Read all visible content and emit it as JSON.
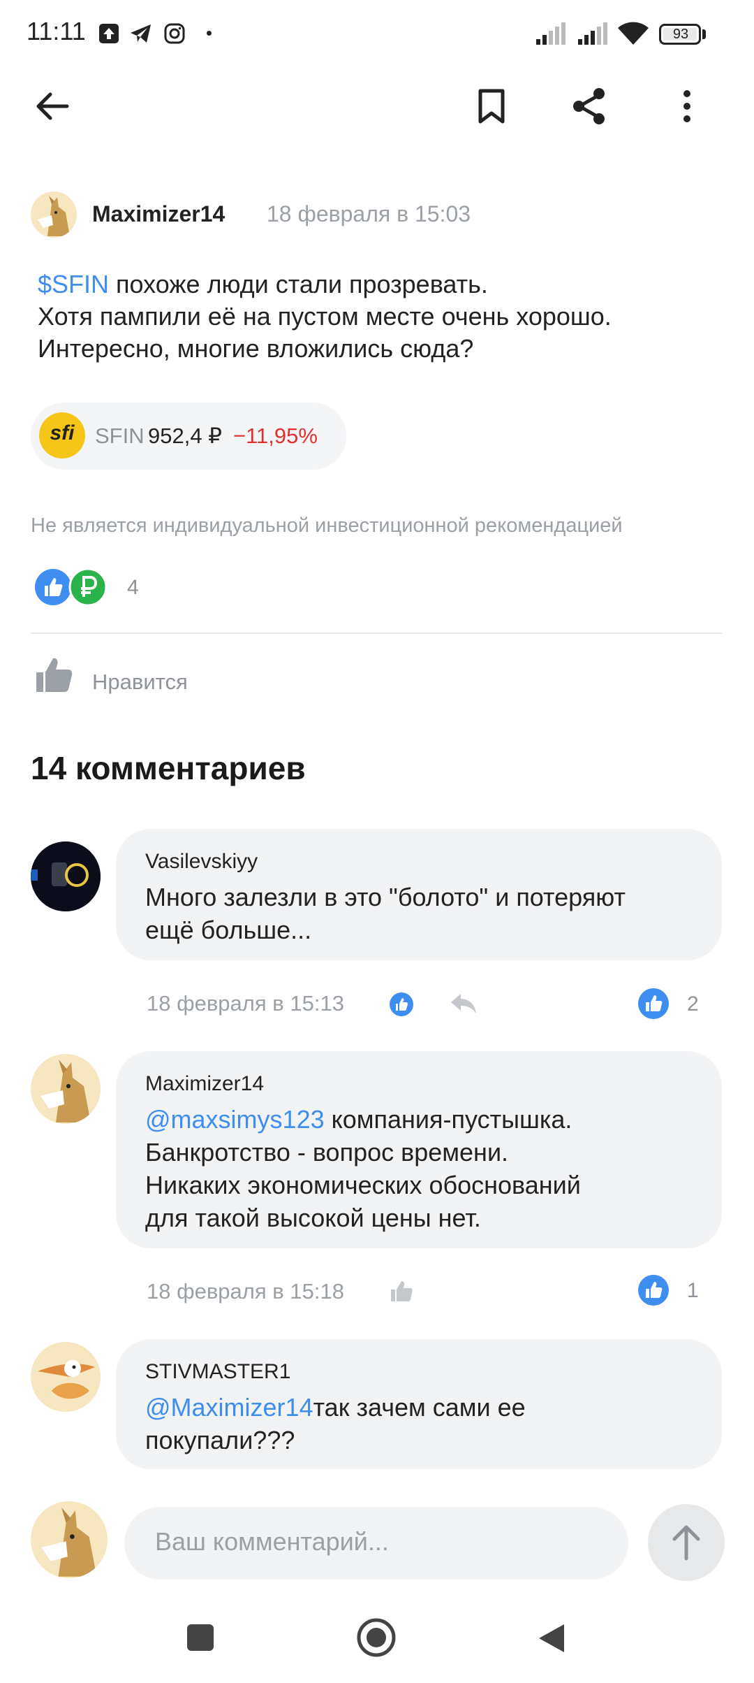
{
  "status_bar": {
    "time": "11:11",
    "battery": "93"
  },
  "post": {
    "author": "Maximizer14",
    "date": "18 февраля в 15:03",
    "ticker_link": "$SFIN",
    "line1_rest": " похоже люди стали прозревать.",
    "line2": "Хотя пампили её на пустом месте очень хорошо.",
    "line3": "Интересно, многие вложились сюда?",
    "instrument": {
      "logo_text": "sfi",
      "ticker": "SFIN",
      "price": "952,4 ₽",
      "change": "−11,95%",
      "change_color": "#e03030"
    },
    "disclaimer": "Не является индивидуальной инвестиционной рекомендацией",
    "reactions_count": "4",
    "like_label": "Нравится"
  },
  "comments_title": "14 комментариев",
  "comments": [
    {
      "author": "Vasilevskiyy",
      "line1": "Много залезли в это \"болото\" и потеряют",
      "line2": "ещё больше...",
      "date": "18 февраля в 15:13",
      "likes": "2"
    },
    {
      "author": "Maximizer14",
      "mention": "@maxsimys123",
      "line1_rest": " компания-пустышка.",
      "line2": "Банкротство - вопрос времени.",
      "line3": "Никаких экономических обоснований",
      "line4": "для такой высокой цены нет.",
      "date": "18 февраля в 15:18",
      "likes": "1"
    },
    {
      "author": "STIVMASTER1",
      "mention": "@Maximizer14",
      "line1_rest": "так зачем сами ее",
      "line2": "покупали???"
    }
  ],
  "comment_input": {
    "placeholder": "Ваш комментарий..."
  },
  "colors": {
    "accent": "#3d8ef0",
    "negative": "#e03030",
    "logo_yellow": "#f5c518"
  }
}
